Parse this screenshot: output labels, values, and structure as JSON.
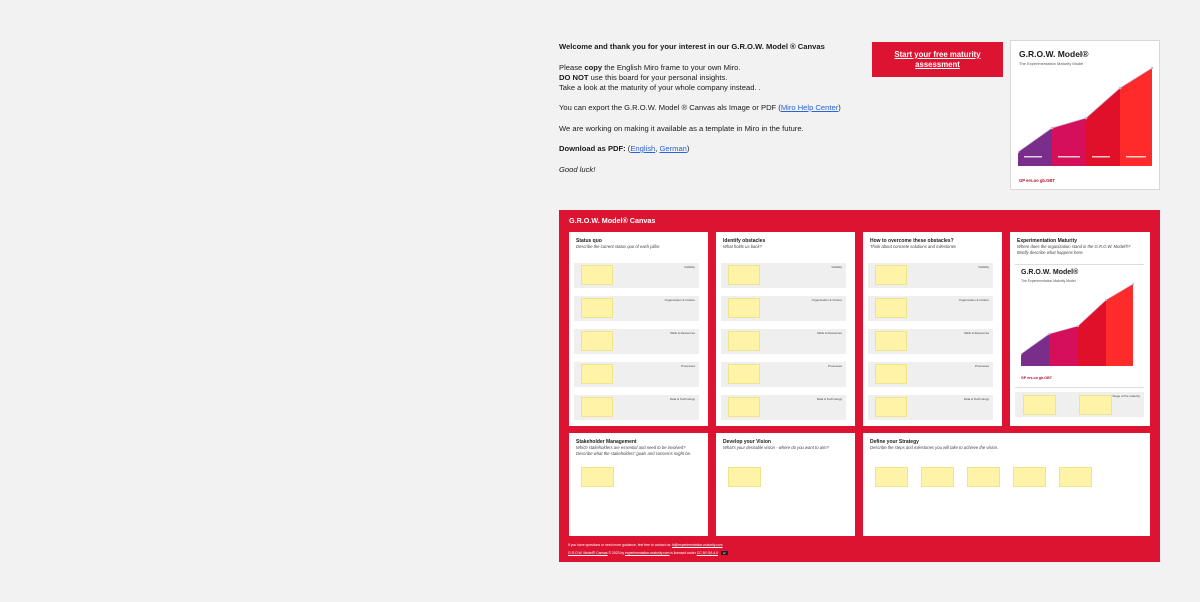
{
  "intro": {
    "welcome": "Welcome and thank you for your interest in our G.R.O.W. Model ® Canvas",
    "line1_a": "Please ",
    "line1_b": "copy",
    "line1_c": " the English Miro frame to your own Miro.",
    "line2_a": "DO NOT",
    "line2_b": " use this board for your personal insights.",
    "line3": "Take a look at the maturity of your whole company instead. .",
    "export_a": "You can export the G.R.O.W. Model ® Canvas als Image or PDF (",
    "export_link": "Miro Help Center",
    "export_b": ")",
    "template": "We are working on making it available as a template in Miro in the future.",
    "download_label": "Download as PDF:",
    "download_open": "  (",
    "download_en": "English",
    "download_sep": ", ",
    "download_de": "German",
    "download_close": ")",
    "goodluck": "Good luck!"
  },
  "cta": {
    "label": "Start your free maturity assessment"
  },
  "card": {
    "title": "G.R.O.W. Model®",
    "subtitle": "The Experimentation Maturity Model",
    "footer": "GP ers.oo gb.GBT"
  },
  "frame": {
    "title": "G.R.O.W. Model® Canvas",
    "pillars": [
      "Visibility",
      "Organization & Culture",
      "Skills & Resources",
      "Processes",
      "Data & Technology"
    ],
    "panels": [
      {
        "heading": "Status quo",
        "desc": "Describe the current status quo of each pillar."
      },
      {
        "heading": "Identify obstacles",
        "desc": "What holds us back?"
      },
      {
        "heading": "How to overcome these obstacles?",
        "desc": "Think about concrete solutions and milestones"
      },
      {
        "heading": "Experimentation Maturity",
        "desc": "Where does the organization stand in the G.R.O.W. Model®? Briefly describe what happens here."
      }
    ],
    "maturity_card": {
      "title": "G.R.O.W. Model®",
      "subtitle": "The Experimentation Maturity Model",
      "footer": "GP ers.oo gb.GBT",
      "stage_label": "Stage of the maturity"
    },
    "bottom_panels": [
      {
        "heading": "Stakeholder Management",
        "desc": "Which stakeholders are essential and need to be involved? Describe what the stakeholders' goals and concerns might be."
      },
      {
        "heading": "Develop your Vision",
        "desc": "What's your desirable vision - where do you want to aim?"
      },
      {
        "heading": "Define your Strategy",
        "desc": "Describe the steps and milestones you will take to achieve the vision."
      }
    ],
    "footer_line1_a": "If you have questions or need more guidance, feel free to contact us: ",
    "footer_line1_link": "hi@experimentation-maturity.com",
    "footer_line2_a": "G.R.O.W. Model® Canvas",
    "footer_line2_b": " © 2023 by ",
    "footer_line2_c": "experimentation-maturity.com",
    "footer_line2_d": " is licensed under ",
    "footer_line2_e": "CC BY-SA 4.0",
    "cc_badge": "cc"
  },
  "colors": {
    "brand_red": "#dc1431",
    "sticky_yellow": "#fff3a8",
    "stage1": "#7a2e8c",
    "stage2": "#d60f5a",
    "stage3": "#e0102a",
    "stage4": "#ff2a2a"
  }
}
